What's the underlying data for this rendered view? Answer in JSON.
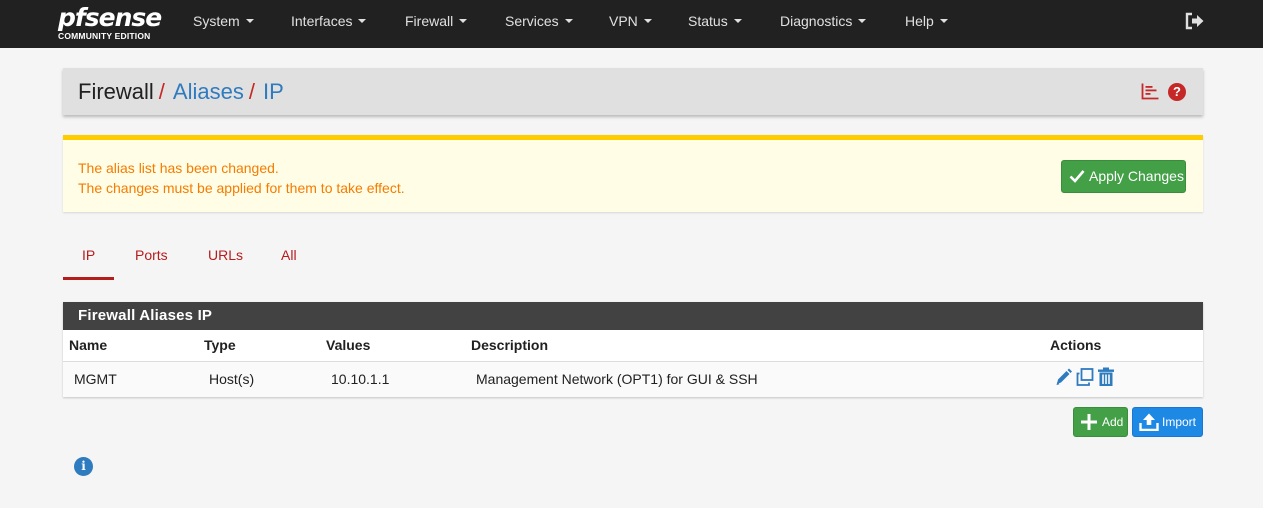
{
  "brand": {
    "logo_pf": "pf",
    "logo_sense": "sense",
    "subtitle": "COMMUNITY EDITION"
  },
  "nav": {
    "items": [
      {
        "label": "System"
      },
      {
        "label": "Interfaces"
      },
      {
        "label": "Firewall"
      },
      {
        "label": "Services"
      },
      {
        "label": "VPN"
      },
      {
        "label": "Status"
      },
      {
        "label": "Diagnostics"
      },
      {
        "label": "Help"
      }
    ],
    "logout_icon": "sign-out-icon"
  },
  "breadcrumb": {
    "items": [
      "Firewall",
      "Aliases",
      "IP"
    ],
    "separator": "/",
    "icons": [
      "chart-icon",
      "help-icon"
    ],
    "help_glyph": "?"
  },
  "alert": {
    "line1": "The alias list has been changed.",
    "line2": "The changes must be applied for them to take effect.",
    "apply_label": "Apply Changes"
  },
  "tabs": {
    "items": [
      "IP",
      "Ports",
      "URLs",
      "All"
    ],
    "active": "IP"
  },
  "table": {
    "title": "Firewall Aliases IP",
    "columns": [
      "Name",
      "Type",
      "Values",
      "Description",
      "Actions"
    ],
    "rows": [
      {
        "name": "MGMT",
        "type": "Host(s)",
        "values": "10.10.1.1",
        "description": "Management Network (OPT1) for GUI & SSH",
        "actions": [
          "edit-icon",
          "copy-icon",
          "delete-icon"
        ]
      }
    ]
  },
  "buttons": {
    "add_label": "Add",
    "import_label": "Import"
  },
  "info_glyph": "i",
  "colors": {
    "navbar": "#212121",
    "accent_red": "#b71c1c",
    "link_blue": "#2f7bbf",
    "alert_text": "#f57c00",
    "alert_border": "#ffcc00",
    "success": "#43a047",
    "primary": "#1e88e5"
  }
}
